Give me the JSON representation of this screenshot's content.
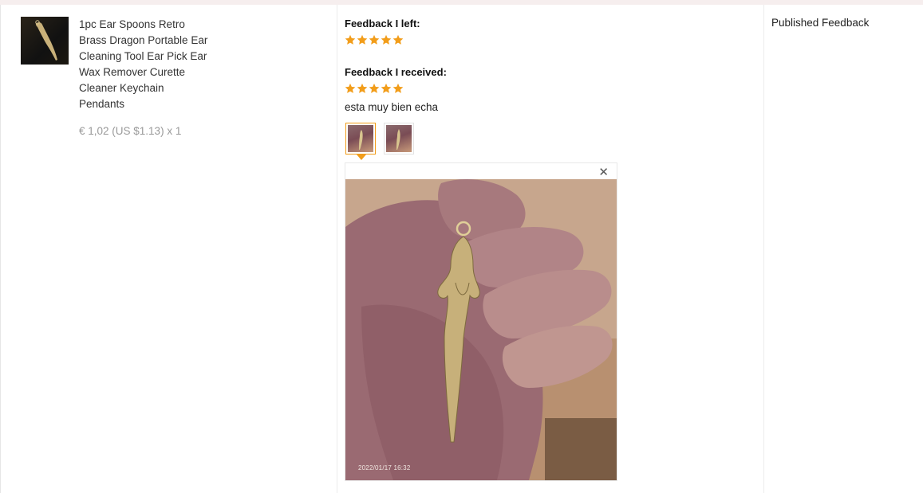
{
  "product": {
    "title_lines": [
      "1pc Ear Spoons Retro",
      "Brass Dragon Portable Ear",
      "Cleaning Tool Ear Pick Ear",
      "Wax Remover Curette",
      "Cleaner Keychain",
      "Pendants"
    ],
    "price": "€ 1,02 (US $1.13) x 1",
    "thumbnail_icon": "product-photo"
  },
  "feedback_left": {
    "heading": "Feedback I left:",
    "rating": 5,
    "max_rating": 5
  },
  "feedback_received": {
    "heading": "Feedback I received:",
    "rating": 5,
    "max_rating": 5,
    "comment": "esta muy bien echa",
    "photo_count": 2,
    "selected_photo": 1
  },
  "photo_viewer": {
    "close_icon": "close-icon",
    "timestamp": "2022/01/17 16:32"
  },
  "status": {
    "label": "Published Feedback"
  },
  "colors": {
    "star": "#f29d1a",
    "active_border": "#f29d1a",
    "price": "#999999",
    "divider": "#ececec"
  }
}
